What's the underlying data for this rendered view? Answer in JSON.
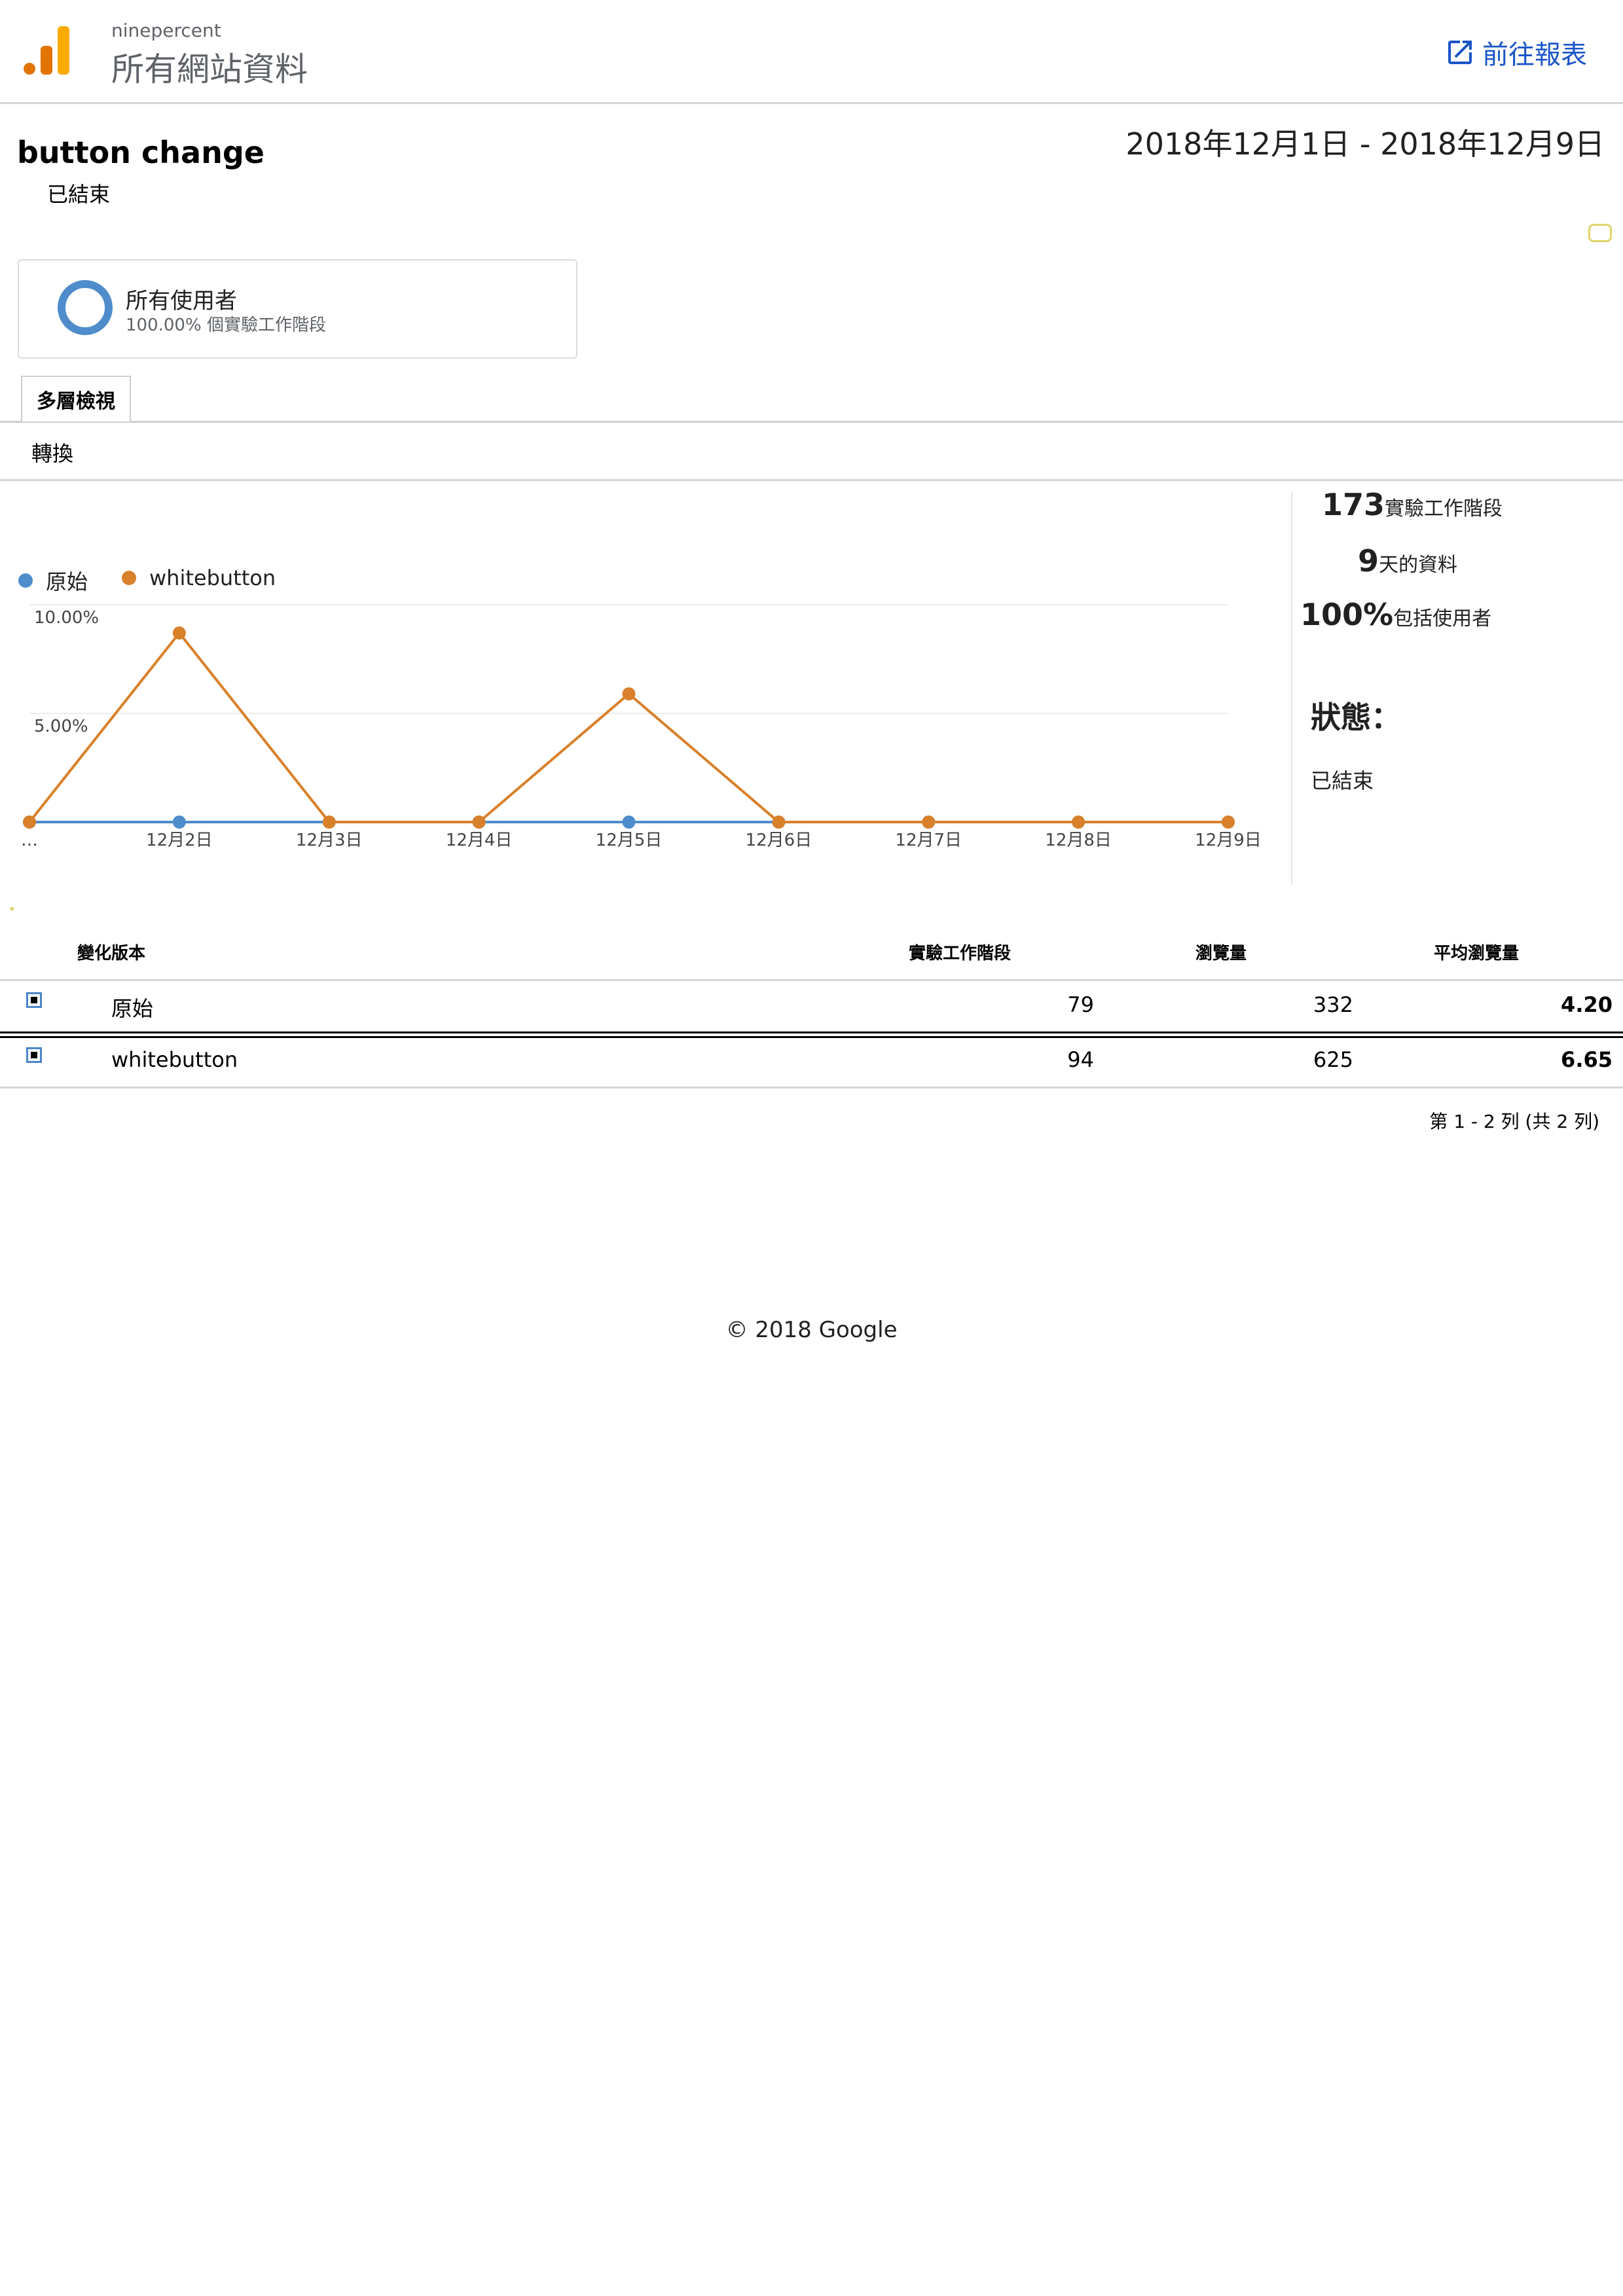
{
  "header": {
    "property_name": "ninepercent",
    "view_name": "所有網站資料",
    "goto_report": "前往報表"
  },
  "experiment": {
    "title": "button change",
    "status": "已結束",
    "date_range": "2018年12月1日 - 2018年12月9日"
  },
  "segment": {
    "name": "所有使用者",
    "subtitle": "100.00% 個實驗工作階段"
  },
  "tabs": [
    {
      "label": "多層檢視",
      "active": true
    }
  ],
  "metric": "轉換",
  "side_stats": {
    "sessions_num": "173",
    "sessions_label": "實驗工作階段",
    "days_num": "9",
    "days_label": "天的資料",
    "users_num": "100%",
    "users_label": "包括使用者",
    "status_title": "狀態：",
    "status_value": "已結束"
  },
  "chart_data": {
    "type": "line",
    "categories": [
      "…",
      "12月2日",
      "12月3日",
      "12月4日",
      "12月5日",
      "12月6日",
      "12月7日",
      "12月8日",
      "12月9日"
    ],
    "series": [
      {
        "name": "原始",
        "color": "#4f8ccb",
        "values": [
          0,
          0,
          0,
          0,
          0,
          0,
          0,
          0,
          0
        ]
      },
      {
        "name": "whitebutton",
        "color": "#d9802a",
        "values": [
          0,
          8.7,
          0,
          0,
          5.9,
          0,
          0,
          0,
          0
        ]
      }
    ],
    "y_ticks": [
      "10.00%",
      "5.00%"
    ],
    "ylim": [
      0,
      10
    ],
    "grid": true,
    "legend_position": "top-left"
  },
  "table": {
    "headers": [
      "變化版本",
      "實驗工作階段",
      "瀏覽量",
      "平均瀏覽量"
    ],
    "rows": [
      {
        "name": "原始",
        "sessions": "79",
        "pageviews": "332",
        "avg": "4.20"
      },
      {
        "name": "whitebutton",
        "sessions": "94",
        "pageviews": "625",
        "avg": "6.65"
      }
    ],
    "pager": "第 1 - 2 列 (共 2 列)"
  },
  "footer": "© 2018 Google"
}
